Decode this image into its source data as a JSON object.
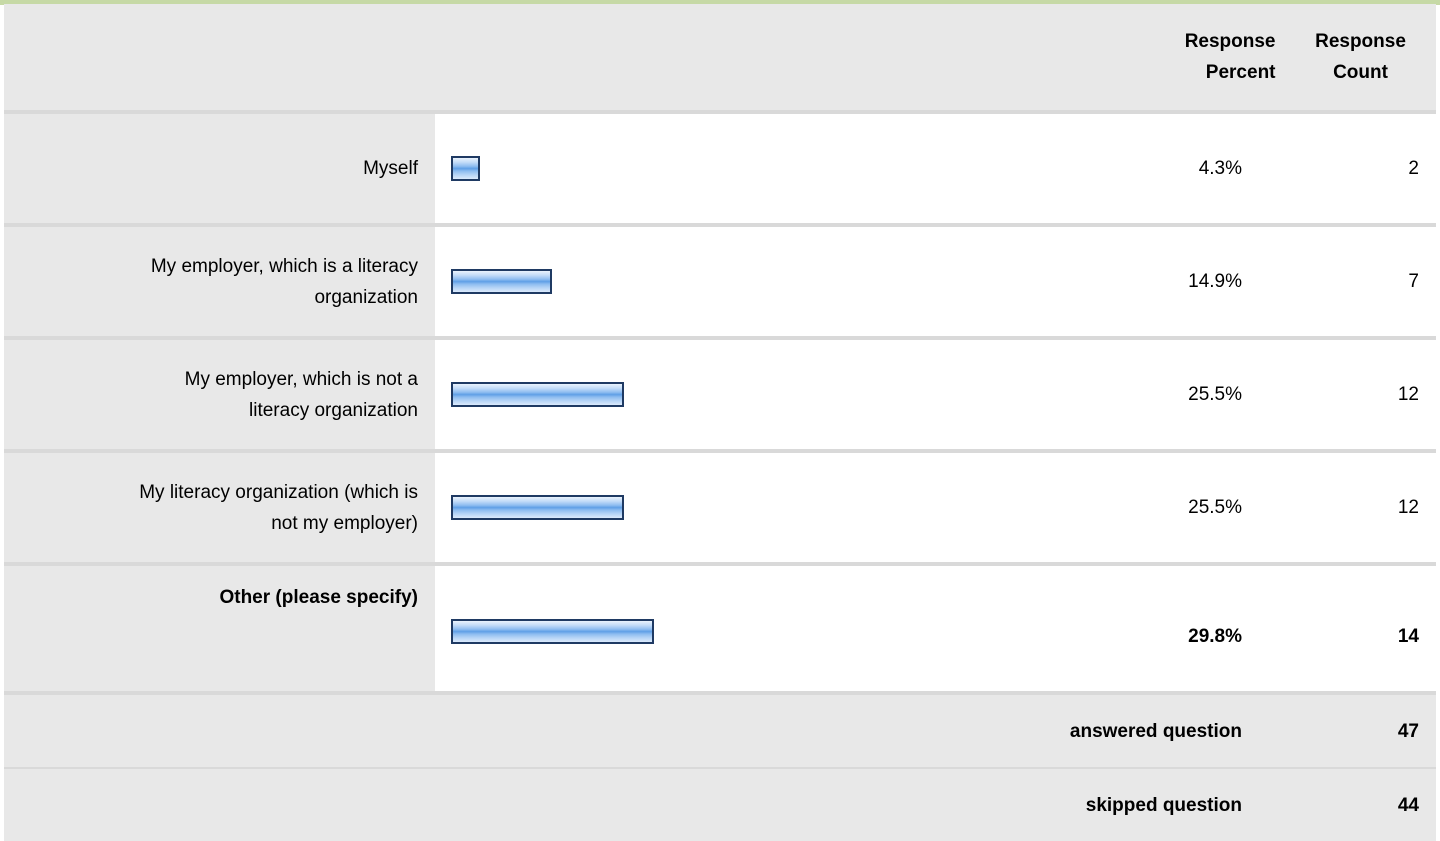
{
  "header": {
    "percent_line1": "Response",
    "percent_line2": "Percent",
    "count_line1": "Response",
    "count_line2": "Count"
  },
  "colors": {
    "label_bg": "#e8e8e8",
    "bar_border": "#1f3a63",
    "bar_fill": "#5f9fe6",
    "separator": "#d9d9d9",
    "top_border": "#c6d9a6"
  },
  "rows": [
    {
      "label_line1": "Myself",
      "label_line2": "",
      "percent": "4.3%",
      "count": "2",
      "fraction": 0.043
    },
    {
      "label_line1": "My employer, which is a literacy",
      "label_line2": "organization",
      "percent": "14.9%",
      "count": "7",
      "fraction": 0.149
    },
    {
      "label_line1": "My employer, which is not a",
      "label_line2": "literacy organization",
      "percent": "25.5%",
      "count": "12",
      "fraction": 0.255
    },
    {
      "label_line1": "My literacy organization (which is",
      "label_line2": "not my employer)",
      "percent": "25.5%",
      "count": "12",
      "fraction": 0.255
    },
    {
      "label_line1": "Other (please specify)",
      "label_line2": "",
      "percent": "29.8%",
      "count": "14",
      "fraction": 0.298
    }
  ],
  "summary": {
    "answered_label": "answered question",
    "answered_count": "47",
    "skipped_label": "skipped question",
    "skipped_count": "44"
  }
}
